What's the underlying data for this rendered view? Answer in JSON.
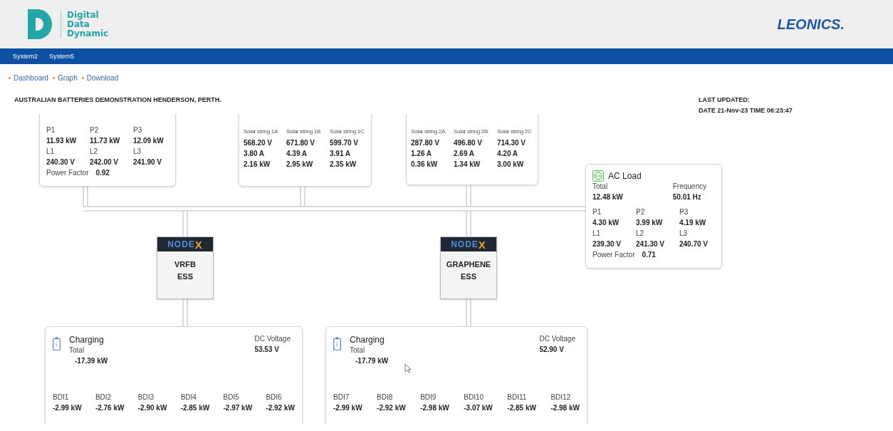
{
  "header": {
    "logo_lines": [
      "Digital",
      "Data",
      "Dynamic"
    ],
    "brand": "LEONICS."
  },
  "nav": [
    {
      "label": "System2"
    },
    {
      "label": "System5"
    }
  ],
  "links": [
    "Dashboard",
    "Graph",
    "Download"
  ],
  "title": "AUSTRALIAN BATTERIES DEMONSTRATION HENDERSON, PERTH.",
  "last_updated": {
    "label": "LAST UPDATED:",
    "value": "DATE 21-Nov-23 TIME 06:23:47"
  },
  "meter_cards": [
    {
      "rows": [
        {
          "kind": "label",
          "cells": [
            "P1",
            "P2",
            "P3"
          ]
        },
        {
          "kind": "value",
          "cells": [
            "11.93 kW",
            "11.73 kW",
            "12.09 kW"
          ]
        },
        {
          "kind": "label",
          "cells": [
            "L1",
            "L2",
            "L3"
          ]
        },
        {
          "kind": "value",
          "cells": [
            "240.30 V",
            "242.00 V",
            "241.90 V"
          ]
        }
      ],
      "power_factor_label": "Power Factor",
      "power_factor": "0.92"
    },
    {
      "rows": [
        {
          "kind": "small",
          "cells": [
            "Solar string 1A",
            "Solar string 1B",
            "Solar string 1C"
          ]
        },
        {
          "kind": "value",
          "cells": [
            "568.20 V",
            "671.80 V",
            "599.70 V"
          ]
        },
        {
          "kind": "value",
          "cells": [
            "3.80 A",
            "4.39 A",
            "3.91 A"
          ]
        },
        {
          "kind": "value",
          "cells": [
            "2.16 kW",
            "2.95 kW",
            "2.35 kW"
          ]
        }
      ]
    },
    {
      "rows": [
        {
          "kind": "small",
          "cells": [
            "Solar string 2A",
            "Solar string 2B",
            "Solar string 2C"
          ]
        },
        {
          "kind": "value",
          "cells": [
            "287.80 V",
            "496.80 V",
            "714.30 V"
          ]
        },
        {
          "kind": "value",
          "cells": [
            "1.26 A",
            "2.69 A",
            "4.20 A"
          ]
        },
        {
          "kind": "value",
          "cells": [
            "0.36 kW",
            "1.34 kW",
            "3.00 kW"
          ]
        }
      ]
    }
  ],
  "ac_load": {
    "title": "AC Load",
    "total_label": "Total",
    "total": "12.48 kW",
    "frequency_label": "Frequency",
    "frequency": "50.01 Hz",
    "rows": [
      {
        "kind": "label",
        "cells": [
          "P1",
          "P2",
          "P3"
        ]
      },
      {
        "kind": "value",
        "cells": [
          "4.30 kW",
          "3.99 kW",
          "4.19 kW"
        ]
      },
      {
        "kind": "label",
        "cells": [
          "L1",
          "L2",
          "L3"
        ]
      },
      {
        "kind": "value",
        "cells": [
          "239.30 V",
          "241.30 V",
          "240.70 V"
        ]
      }
    ],
    "power_factor_label": "Power Factor",
    "power_factor": "0.71"
  },
  "nodes": [
    {
      "brand": "NODE",
      "brand_mark": "X",
      "name": [
        "VRFB",
        "ESS"
      ]
    },
    {
      "brand": "NODE",
      "brand_mark": "X",
      "name": [
        "GRAPHENE",
        "ESS"
      ]
    }
  ],
  "batteries": [
    {
      "status": "Charging",
      "total_label": "Total",
      "total": "-17.39 kW",
      "voltage_label": "DC Voltage",
      "voltage": "53.53 V",
      "bdis": [
        {
          "label": "BDI1",
          "value": "-2.99 kW"
        },
        {
          "label": "BDI2",
          "value": "-2.76 kW"
        },
        {
          "label": "BDI3",
          "value": "-2.90 kW"
        },
        {
          "label": "BDI4",
          "value": "-2.85 kW"
        },
        {
          "label": "BDI5",
          "value": "-2.97 kW"
        },
        {
          "label": "BDI6",
          "value": "-2.92 kW"
        }
      ]
    },
    {
      "status": "Charging",
      "total_label": "Total",
      "total": "-17.79 kW",
      "voltage_label": "DC Voltage",
      "voltage": "52.90 V",
      "bdis": [
        {
          "label": "BDI7",
          "value": "-2.99 kW"
        },
        {
          "label": "BDI8",
          "value": "-2.92 kW"
        },
        {
          "label": "BDI9",
          "value": "-2.98 kW"
        },
        {
          "label": "BDI10",
          "value": "-3.07 kW"
        },
        {
          "label": "BDI11",
          "value": "-2.85 kW"
        },
        {
          "label": "BDI12",
          "value": "-2.98 kW"
        }
      ]
    }
  ]
}
